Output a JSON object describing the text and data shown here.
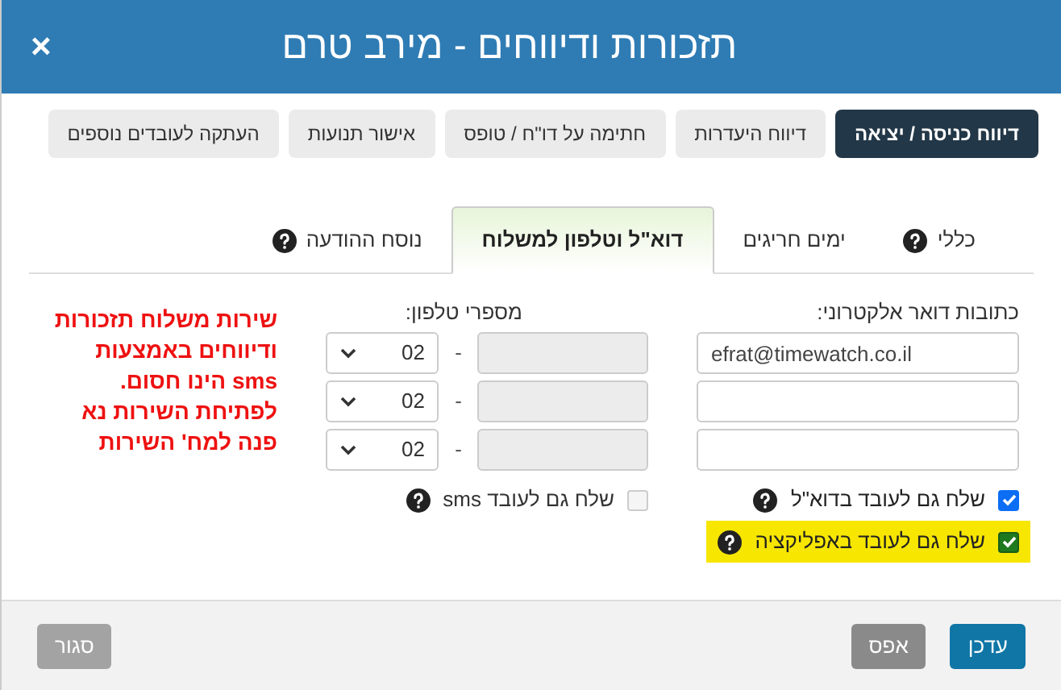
{
  "window": {
    "title": "תזכורות ודיווחים - מירב טרם",
    "close": "×"
  },
  "top_buttons": [
    {
      "label": "דיווח כניסה / יציאה",
      "selected": true
    },
    {
      "label": "דיווח היעדרות",
      "selected": false
    },
    {
      "label": "חתימה על דו\"ח / טופס",
      "selected": false
    },
    {
      "label": "אישור תנועות",
      "selected": false
    },
    {
      "label": "העתקה לעובדים נוספים",
      "selected": false
    }
  ],
  "tabs": [
    {
      "label": "כללי",
      "help": true,
      "selected": false
    },
    {
      "label": "ימים חריגים",
      "help": false,
      "selected": false
    },
    {
      "label": "דוא\"ל וטלפון למשלוח",
      "help": false,
      "selected": true
    },
    {
      "label": "נוסח ההודעה",
      "help": true,
      "selected": false
    }
  ],
  "email": {
    "label": "כתובות דואר אלקטרוני:",
    "fields": [
      {
        "kind": "filled",
        "value": "efrat@timewatch.co.il"
      },
      {
        "kind": "blank"
      },
      {
        "kind": "blank"
      }
    ]
  },
  "phone": {
    "label": "מספרי טלפון:",
    "rows": [
      {
        "prefix": "02",
        "separator": "-",
        "disabled": true
      },
      {
        "prefix": "02",
        "separator": "-",
        "disabled": true
      },
      {
        "prefix": "02",
        "separator": "-",
        "disabled": true
      }
    ]
  },
  "notice_lines": [
    "שירות משלוח תזכורות",
    "ודיווחים באמצעות",
    "sms הינו חסום.",
    "לפתיחת השירות נא",
    "פנה למח' השירות"
  ],
  "checkboxes": [
    {
      "label": "שלח גם לעובד בדוא\"ל",
      "checked": true,
      "disabled": false,
      "highlighted": false
    },
    {
      "label": "שלח גם לעובד sms",
      "checked": false,
      "disabled": true,
      "highlighted": false
    },
    {
      "label": "שלח גם לעובד באפליקציה",
      "checked": true,
      "disabled": false,
      "highlighted": true
    }
  ],
  "footer": {
    "buttons": [
      {
        "label": "עדכן",
        "kind": "primary"
      },
      {
        "label": "אפס",
        "kind": "secondary"
      },
      {
        "label": "סגור",
        "kind": "close"
      }
    ]
  }
}
